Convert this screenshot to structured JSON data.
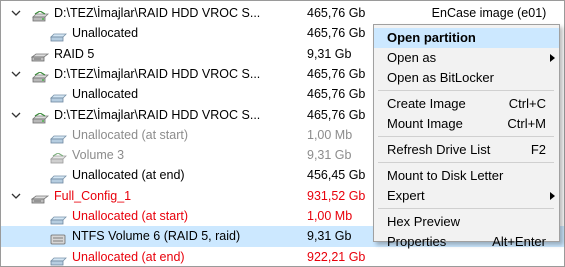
{
  "tree": [
    {
      "indent": 0,
      "chevron": true,
      "icon": "drive-image-icon",
      "name": "D:\\TEZ\\İmajlar\\RAID HDD VROC S...",
      "size": "465,76 Gb",
      "desc": "EnCase image (e01)",
      "color": "black"
    },
    {
      "indent": 1,
      "chevron": false,
      "icon": "unallocated-icon",
      "name": "Unallocated",
      "size": "465,76 Gb",
      "desc": "",
      "color": "black"
    },
    {
      "indent": 0,
      "chevron": false,
      "icon": "raid-icon",
      "name": "RAID 5",
      "size": "9,31 Gb",
      "desc": "",
      "color": "black"
    },
    {
      "indent": 0,
      "chevron": true,
      "icon": "drive-image-icon",
      "name": "D:\\TEZ\\İmajlar\\RAID HDD VROC S...",
      "size": "465,76 Gb",
      "desc": "",
      "color": "black"
    },
    {
      "indent": 1,
      "chevron": false,
      "icon": "unallocated-icon",
      "name": "Unallocated",
      "size": "465,76 Gb",
      "desc": "",
      "color": "black"
    },
    {
      "indent": 0,
      "chevron": true,
      "icon": "drive-image-icon",
      "name": "D:\\TEZ\\İmajlar\\RAID HDD VROC S...",
      "size": "465,76 Gb",
      "desc": "",
      "color": "black"
    },
    {
      "indent": 1,
      "chevron": false,
      "icon": "unallocated-icon",
      "name": "Unallocated (at start)",
      "size": "1,00 Mb",
      "desc": "",
      "color": "gray"
    },
    {
      "indent": 1,
      "chevron": false,
      "icon": "volume-icon",
      "name": "Volume 3",
      "size": "9,31 Gb",
      "desc": "",
      "color": "gray"
    },
    {
      "indent": 1,
      "chevron": false,
      "icon": "unallocated-icon",
      "name": "Unallocated (at end)",
      "size": "456,45 Gb",
      "desc": "",
      "color": "black"
    },
    {
      "indent": 0,
      "chevron": true,
      "icon": "raid-icon",
      "name": "Full_Config_1",
      "size": "931,52 Gb",
      "desc": "",
      "color": "red"
    },
    {
      "indent": 1,
      "chevron": false,
      "icon": "unallocated-icon",
      "name": "Unallocated (at start)",
      "size": "1,00 Mb",
      "desc": "",
      "color": "red"
    },
    {
      "indent": 1,
      "chevron": false,
      "icon": "ntfs-volume-icon",
      "name": "NTFS Volume 6 (RAID 5, raid)",
      "size": "9,31 Gb",
      "desc": "",
      "color": "black",
      "selected": true
    },
    {
      "indent": 1,
      "chevron": false,
      "icon": "unallocated-icon",
      "name": "Unallocated (at end)",
      "size": "922,21 Gb",
      "desc": "",
      "color": "red"
    }
  ],
  "context_menu": {
    "items": [
      {
        "label": "Open partition",
        "shortcut": "",
        "submenu": false,
        "highlighted": true,
        "sep_after": false
      },
      {
        "label": "Open as",
        "shortcut": "",
        "submenu": true,
        "highlighted": false,
        "sep_after": false
      },
      {
        "label": "Open as BitLocker",
        "shortcut": "",
        "submenu": false,
        "highlighted": false,
        "sep_after": true
      },
      {
        "label": "Create Image",
        "shortcut": "Ctrl+C",
        "submenu": false,
        "highlighted": false,
        "sep_after": false
      },
      {
        "label": "Mount Image",
        "shortcut": "Ctrl+M",
        "submenu": false,
        "highlighted": false,
        "sep_after": true
      },
      {
        "label": "Refresh Drive List",
        "shortcut": "F2",
        "submenu": false,
        "highlighted": false,
        "sep_after": true
      },
      {
        "label": "Mount to Disk Letter",
        "shortcut": "",
        "submenu": false,
        "highlighted": false,
        "sep_after": false
      },
      {
        "label": "Expert",
        "shortcut": "",
        "submenu": true,
        "highlighted": false,
        "sep_after": true
      },
      {
        "label": "Hex Preview",
        "shortcut": "",
        "submenu": false,
        "highlighted": false,
        "sep_after": false
      },
      {
        "label": "Properties",
        "shortcut": "Alt+Enter",
        "submenu": false,
        "highlighted": false,
        "sep_after": false
      }
    ]
  },
  "colors": {
    "red": "#e8000b",
    "gray": "#8c8c8c",
    "selection": "#cce8ff",
    "menu_bg": "#f2f2f2"
  }
}
